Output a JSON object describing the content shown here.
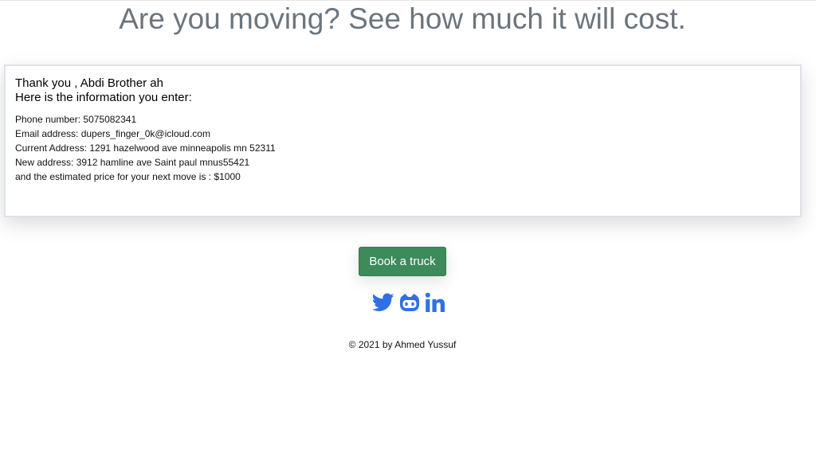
{
  "header": {
    "title": "Are you moving? See how much it will cost."
  },
  "summary": {
    "greeting": "Thank you , Abdi Brother ah",
    "intro": "Here is the information you enter:",
    "rows": [
      "Phone number: 5075082341",
      "Email address: dupers_finger_0k@icloud.com",
      "Current Address: 1291 hazelwood ave minneapolis mn 52311",
      "New address: 3912 hamline ave Saint paul mnus55421",
      "and the estimated price for your next move is : $1000"
    ]
  },
  "actions": {
    "book_label": "Book a truck"
  },
  "social": {
    "icons": [
      "twitter-icon",
      "github-icon",
      "linkedin-icon"
    ],
    "color": "#2f6fe8"
  },
  "footer": {
    "copyright": "© 2021 by Ahmed Yussuf"
  },
  "colors": {
    "button": "#3d8a5a",
    "title": "#6c757d"
  }
}
